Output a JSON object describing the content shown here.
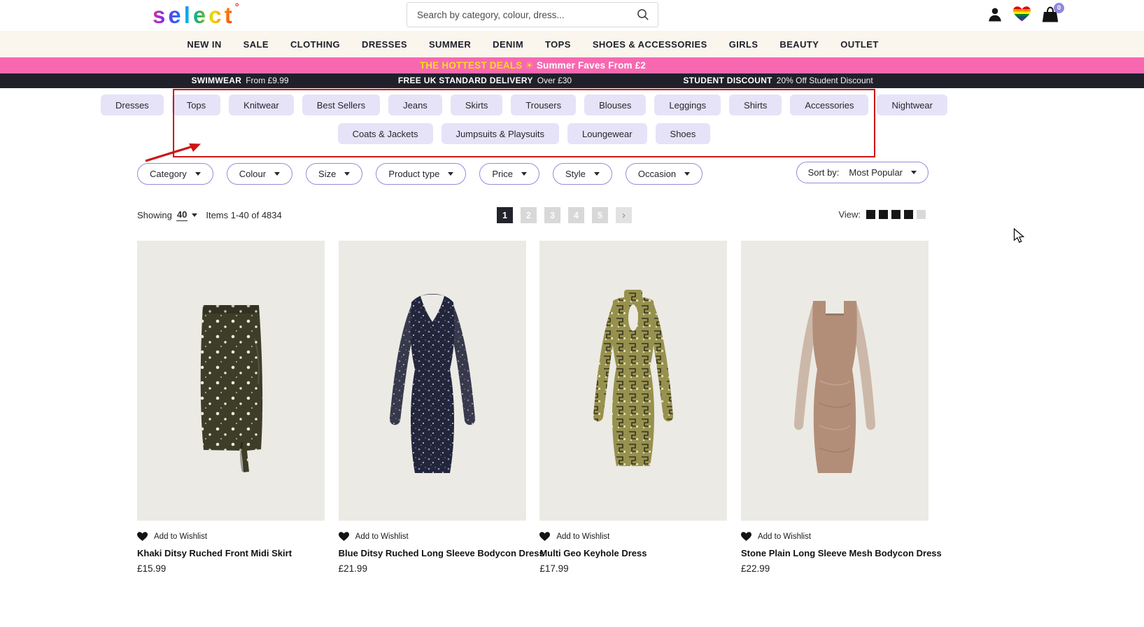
{
  "header": {
    "logo_text": "select",
    "logo_mark": "°",
    "search_placeholder": "Search by category, colour, dress...",
    "cart_count": "0"
  },
  "nav": {
    "items": [
      "NEW IN",
      "SALE",
      "CLOTHING",
      "DRESSES",
      "SUMMER",
      "DENIM",
      "TOPS",
      "SHOES & ACCESSORIES",
      "GIRLS",
      "BEAUTY",
      "OUTLET"
    ],
    "bg": "#FAF6ED"
  },
  "promo": {
    "deal": "THE HOTTEST DEALS",
    "sun": "☀",
    "rest": "Summer Faves From £2",
    "bg": "#F768B1",
    "deal_color": "#F3DF18"
  },
  "infobar": {
    "bg": "#20202A",
    "items": [
      {
        "bold": "SWIMWEAR",
        "text": "From £9.99"
      },
      {
        "bold": "FREE UK STANDARD DELIVERY",
        "text": "Over £30"
      },
      {
        "bold": "STUDENT DISCOUNT",
        "text": "20% Off Student Discount"
      }
    ]
  },
  "quick_categories": {
    "pill_bg": "#E6E3F8",
    "row1": [
      "Dresses",
      "Tops",
      "Knitwear",
      "Best Sellers",
      "Jeans",
      "Skirts",
      "Trousers",
      "Blouses",
      "Leggings",
      "Shirts",
      "Accessories",
      "Nightwear"
    ],
    "row2": [
      "Coats & Jackets",
      "Jumpsuits & Playsuits",
      "Loungewear",
      "Shoes"
    ]
  },
  "annotation": {
    "color": "#CE1412"
  },
  "filters": {
    "dropdowns": [
      "Category",
      "Colour",
      "Size",
      "Product type",
      "Price",
      "Style",
      "Occasion"
    ],
    "sort_label": "Sort by:",
    "sort_value": "Most Popular",
    "border_color": "#938CDC"
  },
  "results": {
    "showing_label": "Showing",
    "page_size": "40",
    "items_text": "Items 1-40 of 4834",
    "pages": [
      "1",
      "2",
      "3",
      "4",
      "5"
    ],
    "active_page": "1",
    "next_symbol": "›",
    "view_label": "View:",
    "view_total": 5,
    "view_active": 4
  },
  "products": [
    {
      "name": "Khaki Ditsy Ruched Front Midi Skirt",
      "price": "£15.99",
      "wishlist_label": "Add to Wishlist",
      "style": "midi-skirt",
      "colors": {
        "base": "#3E3D28",
        "accent": "#EFEBD8"
      }
    },
    {
      "name": "Blue Ditsy Ruched Long Sleeve Bodycon Dress",
      "price": "£21.99",
      "wishlist_label": "Add to Wishlist",
      "style": "bodycon",
      "colors": {
        "base": "#23263A",
        "accent": "#8C94C4",
        "accent2": "#E6E8F4"
      }
    },
    {
      "name": "Multi Geo Keyhole Dress",
      "price": "£17.99",
      "wishlist_label": "Add to Wishlist",
      "style": "geo-keyhole",
      "colors": {
        "base": "#97914F",
        "accent": "#35341F",
        "accent2": "#E3DBA8"
      }
    },
    {
      "name": "Stone Plain Long Sleeve Mesh Bodycon Dress",
      "price": "£22.99",
      "wishlist_label": "Add to Wishlist",
      "style": "mesh-bodycon",
      "colors": {
        "base": "#B28E79",
        "accent": "#C9A48D"
      }
    }
  ]
}
